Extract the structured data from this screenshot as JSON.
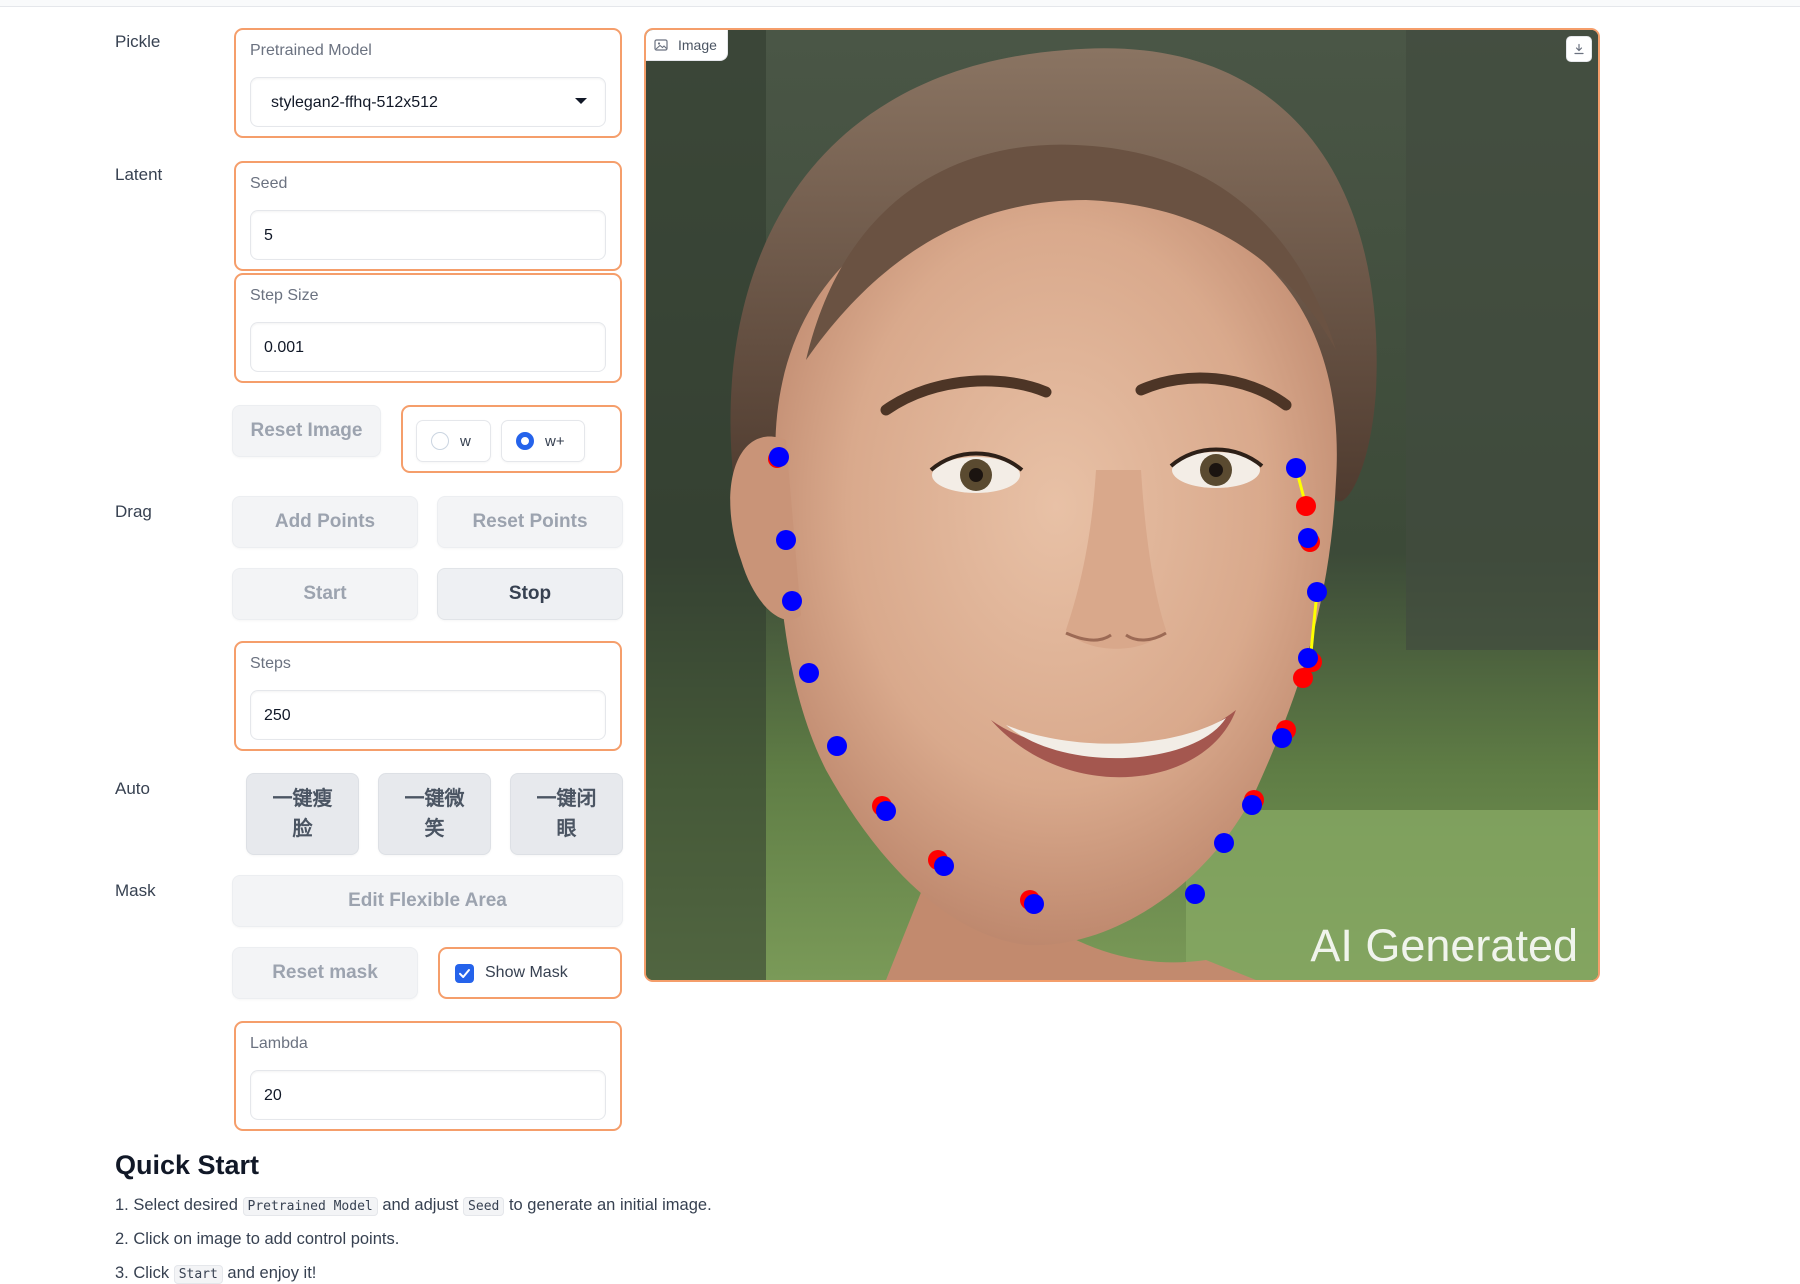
{
  "sections": {
    "pickle": "Pickle",
    "latent": "Latent",
    "drag": "Drag",
    "auto": "Auto",
    "mask": "Mask"
  },
  "pretrained_model": {
    "label": "Pretrained Model",
    "value": "stylegan2-ffhq-512x512"
  },
  "seed": {
    "label": "Seed",
    "value": "5"
  },
  "step_size": {
    "label": "Step Size",
    "value": "0.001"
  },
  "reset_image": "Reset Image",
  "latent_space": {
    "options": [
      "w",
      "w+"
    ],
    "selected": "w+"
  },
  "add_points": "Add Points",
  "reset_points": "Reset Points",
  "start": "Start",
  "stop": "Stop",
  "steps": {
    "label": "Steps",
    "value": "250"
  },
  "auto_buttons": [
    "一键瘦脸",
    "一键微笑",
    "一键闭眼"
  ],
  "edit_flexible_area": "Edit Flexible Area",
  "reset_mask": "Reset mask",
  "show_mask": {
    "label": "Show Mask",
    "checked": true
  },
  "lambda": {
    "label": "Lambda",
    "value": "20"
  },
  "image_panel": {
    "tag": "Image",
    "watermark": "AI Generated"
  },
  "quick_start": {
    "title": "Quick Start",
    "line1": {
      "a": "1. Select desired ",
      "code1": "Pretrained Model",
      "b": " and adjust ",
      "code2": "Seed",
      "c": " to generate an initial image."
    },
    "line2": "2. Click on image to add control points.",
    "line3": {
      "a": "3. Click ",
      "code": "Start",
      "b": " and enjoy it!"
    }
  },
  "colors": {
    "accent_border": "#f59e6b",
    "handle_point": "#0000ff",
    "target_point": "#ff0000",
    "drag_line": "#ffff00"
  }
}
